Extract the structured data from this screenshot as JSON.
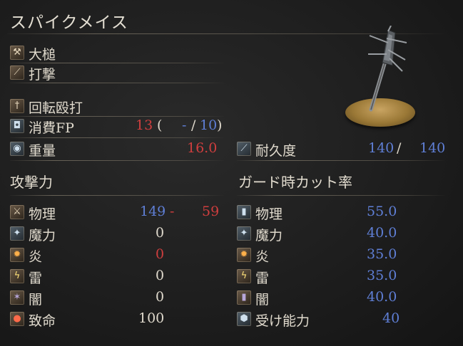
{
  "item": {
    "name": "スパイクメイス",
    "weapon_type": "大槌",
    "attack_type": "打撃",
    "skill": "回転殴打",
    "fp_cost_label": "消費FP",
    "fp_cost": "13",
    "fp_paren_open": "(",
    "fp_current": "-",
    "fp_slash": "/",
    "fp_max": "10",
    "fp_paren_close": ")",
    "weight_label": "重量",
    "weight": "16.0",
    "durability_label": "耐久度",
    "durability_current": "140",
    "durability_slash": "/",
    "durability_max": "140"
  },
  "attack": {
    "header": "攻撃力",
    "rows": [
      {
        "label": "物理",
        "value": "149",
        "dash": "-",
        "bonus": "59",
        "icon": "sword-icon"
      },
      {
        "label": "魔力",
        "value": "0",
        "icon": "magic-icon"
      },
      {
        "label": "炎",
        "value": "0",
        "icon": "fire-icon"
      },
      {
        "label": "雷",
        "value": "0",
        "icon": "lightning-icon"
      },
      {
        "label": "闇",
        "value": "0",
        "icon": "dark-icon"
      },
      {
        "label": "致命",
        "value": "100",
        "icon": "critical-icon"
      }
    ]
  },
  "guard": {
    "header": "ガード時カット率",
    "rows": [
      {
        "label": "物理",
        "value": "55.0",
        "icon": "physical-shield-icon"
      },
      {
        "label": "魔力",
        "value": "40.0",
        "icon": "magic-shield-icon"
      },
      {
        "label": "炎",
        "value": "35.0",
        "icon": "fire-shield-icon"
      },
      {
        "label": "雷",
        "value": "35.0",
        "icon": "lightning-shield-icon"
      },
      {
        "label": "闇",
        "value": "40.0",
        "icon": "dark-shield-icon"
      },
      {
        "label": "受け能力",
        "value": "40",
        "icon": "stability-icon"
      }
    ]
  },
  "colors": {
    "blue_value": "#5f7fd6",
    "red_value": "#cf3e3e",
    "text": "#e0dacd"
  }
}
